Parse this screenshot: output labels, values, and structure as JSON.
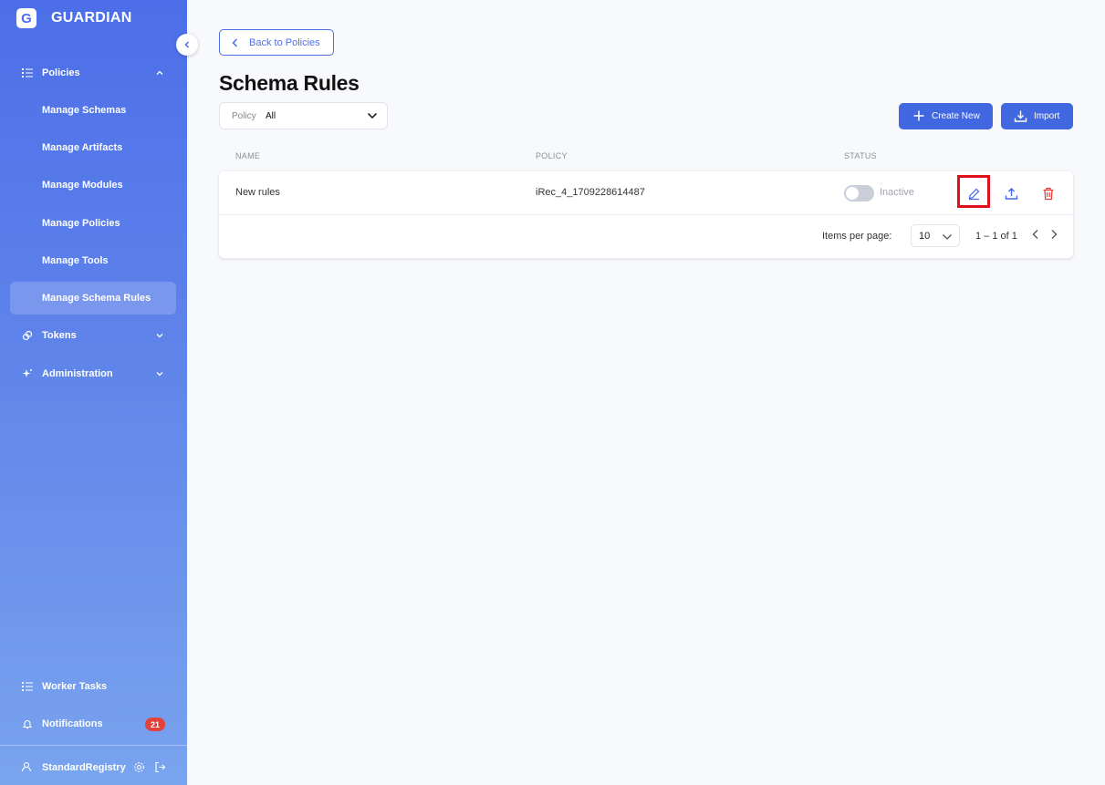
{
  "brand": {
    "logo_letter": "G",
    "name": "GUARDIAN"
  },
  "colors": {
    "accent": "#4167e1",
    "danger": "#e5413b",
    "highlight": "#e0101b"
  },
  "sidebar": {
    "items": [
      {
        "label": "Policies",
        "icon": "list-icon",
        "expanded": true
      },
      {
        "label": "Manage Schemas"
      },
      {
        "label": "Manage Artifacts"
      },
      {
        "label": "Manage Modules"
      },
      {
        "label": "Manage Policies"
      },
      {
        "label": "Manage Tools"
      },
      {
        "label": "Manage Schema Rules",
        "active": true
      },
      {
        "label": "Tokens",
        "icon": "token-icon"
      },
      {
        "label": "Administration",
        "icon": "sparkle-icon"
      }
    ],
    "bottom": {
      "worker_tasks": "Worker Tasks",
      "notifications": "Notifications",
      "notifications_count": "21",
      "user": "StandardRegistry"
    }
  },
  "main": {
    "back_label": "Back to Policies",
    "title": "Schema Rules",
    "filter": {
      "label": "Policy",
      "value": "All"
    },
    "create_label": "Create New",
    "import_label": "Import",
    "columns": [
      "NAME",
      "POLICY",
      "STATUS"
    ],
    "rows": [
      {
        "name": "New rules",
        "policy": "iRec_4_1709228614487",
        "status": "Inactive",
        "active": false
      }
    ],
    "pager": {
      "label": "Items per page:",
      "per_page": "10",
      "range": "1 – 1 of 1"
    }
  }
}
